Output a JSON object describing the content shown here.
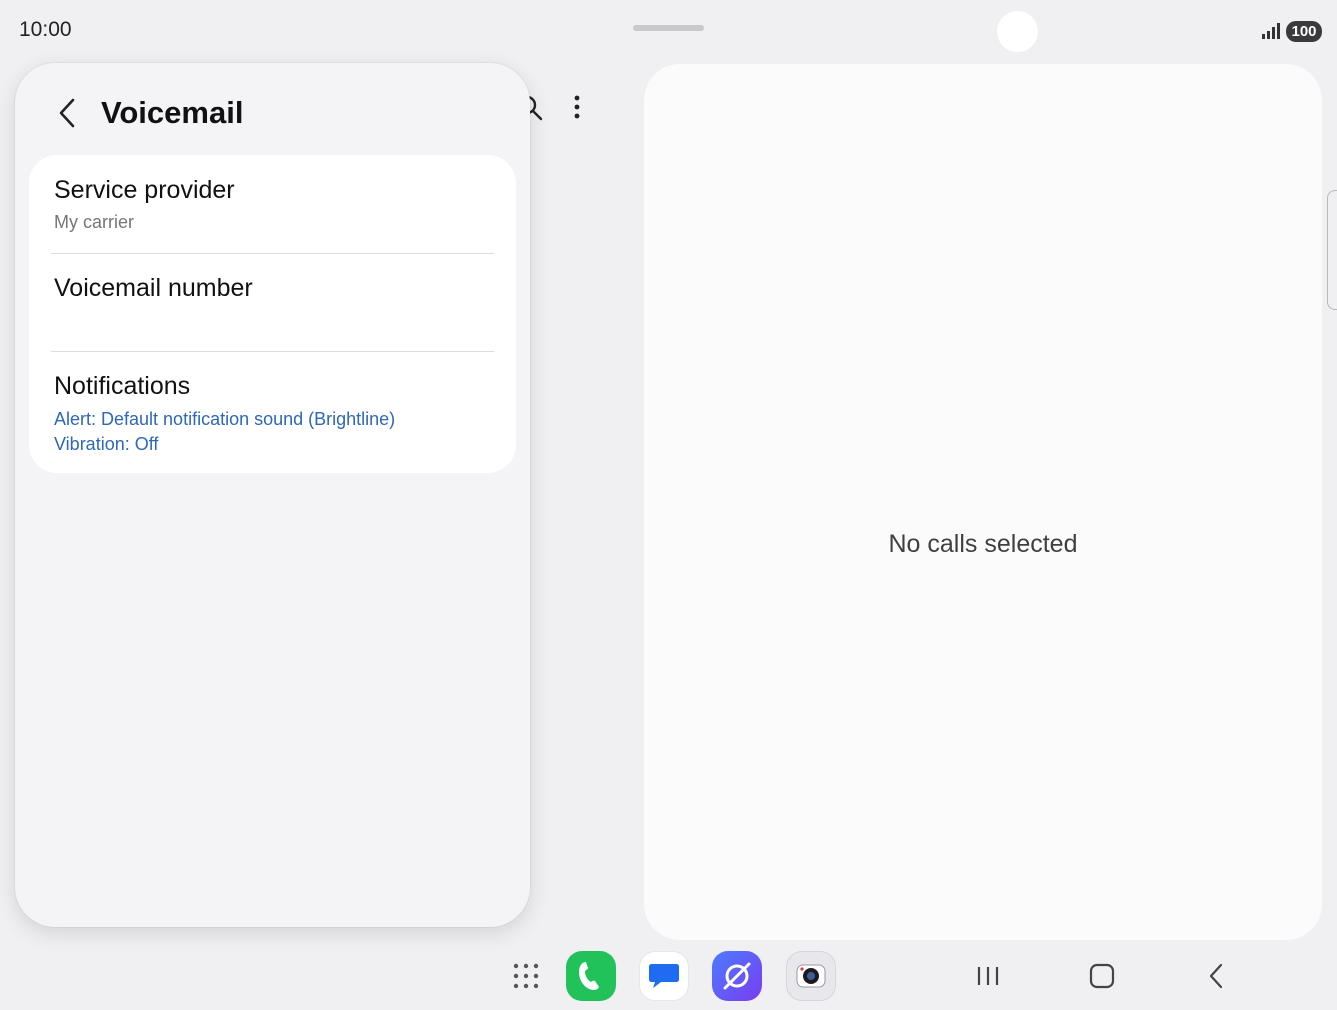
{
  "status_bar": {
    "time": "10:00",
    "battery": "100",
    "icons": [
      "signal-icon",
      "battery-icon"
    ]
  },
  "toolbar_background": {
    "icons": [
      "search-icon",
      "more-vert-icon"
    ]
  },
  "popup": {
    "title": "Voicemail",
    "back_icon": "chevron-left-icon",
    "settings": [
      {
        "title": "Service provider",
        "summary": "My carrier"
      },
      {
        "title": "Voicemail number",
        "summary": ""
      },
      {
        "title": "Notifications",
        "summary_lines": [
          "Alert: Default notification sound (Brightline)",
          "Vibration: Off"
        ]
      }
    ]
  },
  "detail_pane": {
    "empty_text": "No calls selected"
  },
  "taskbar": {
    "apps": [
      "apps-grid-icon",
      "phone-app-icon",
      "messages-app-icon",
      "internet-app-icon",
      "camera-app-icon"
    ],
    "nav": [
      "recents-icon",
      "home-icon",
      "back-icon"
    ]
  },
  "colors": {
    "accent_blue": "#2e68b8",
    "phone_green": "#22c25a"
  }
}
